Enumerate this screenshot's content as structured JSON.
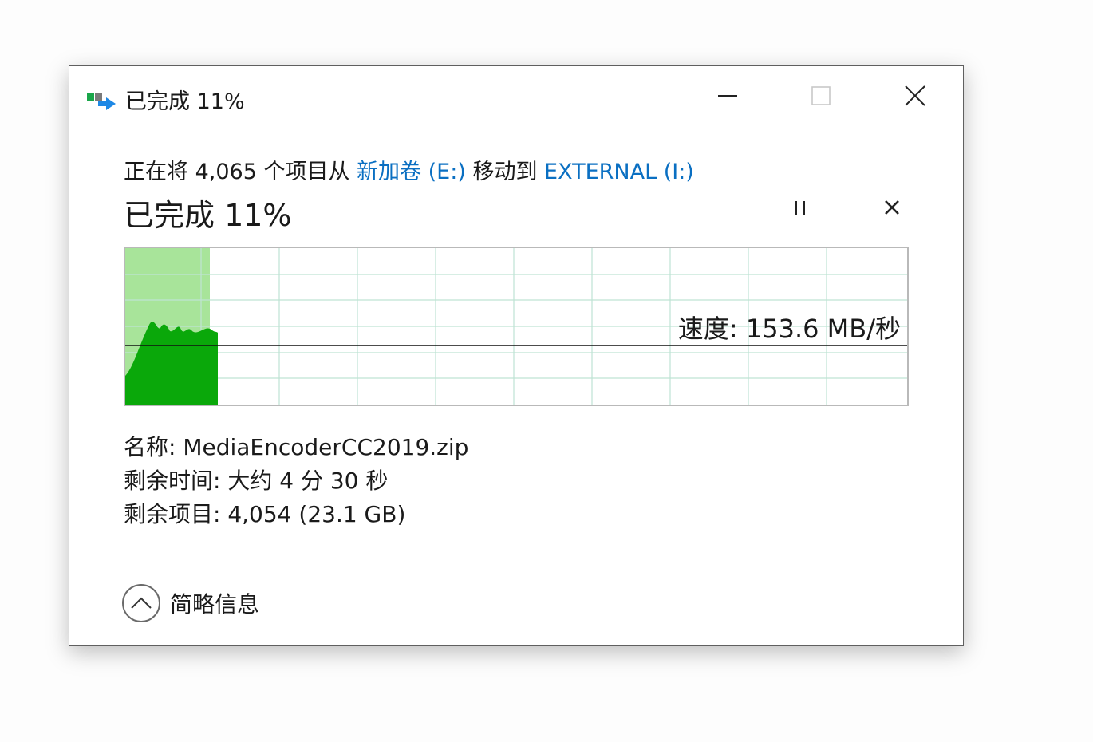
{
  "window": {
    "title": "已完成 11%",
    "minimize_icon": "minimize-icon",
    "maximize_icon": "maximize-icon",
    "close_icon": "close-icon"
  },
  "operation": {
    "prefix": "正在将 4,065 个项目从 ",
    "source": "新加卷 (E:)",
    "middle": " 移动到 ",
    "destination": "EXTERNAL  (I:)"
  },
  "progress": {
    "label": "已完成 11%",
    "fraction": 0.11,
    "speed_label": "速度: 153.6 MB/秒"
  },
  "controls": {
    "pause_icon": "pause-icon",
    "cancel_icon": "cancel-icon"
  },
  "details": {
    "name": "名称: MediaEncoderCC2019.zip",
    "time_remaining": "剩余时间: 大约 4 分 30 秒",
    "items_remaining": "剩余项目: 4,054 (23.1 GB)"
  },
  "footer": {
    "less_details_label": "简略信息",
    "chevron_icon": "chevron-up-icon"
  },
  "colors": {
    "link": "#0a6fc2",
    "progress_fill": "#a8e49a",
    "throughput_fill": "#0aa80a",
    "grid": "#bfe3d4"
  }
}
